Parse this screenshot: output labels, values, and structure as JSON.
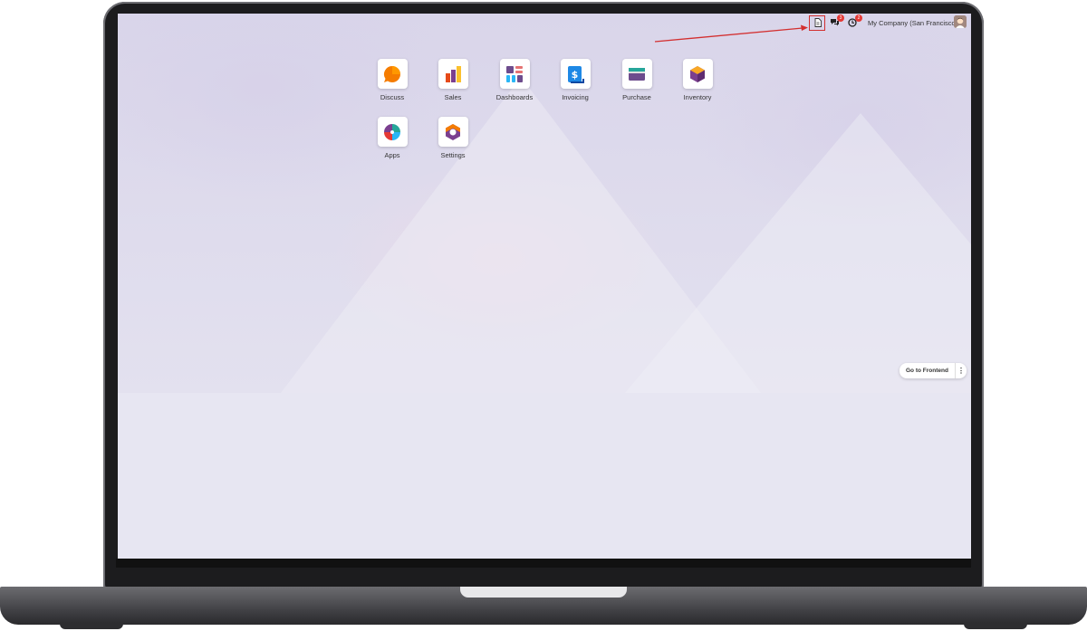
{
  "systray": {
    "company_name": "My Company (San Francisco)",
    "messages_badge": "3",
    "activities_badge": "2",
    "icons": [
      "document-icon",
      "chat-icon",
      "clock-icon",
      "user-avatar"
    ]
  },
  "apps": [
    {
      "label": "Discuss",
      "icon": "discuss-icon"
    },
    {
      "label": "Sales",
      "icon": "sales-icon"
    },
    {
      "label": "Dashboards",
      "icon": "dashboards-icon"
    },
    {
      "label": "Invoicing",
      "icon": "invoicing-icon"
    },
    {
      "label": "Purchase",
      "icon": "purchase-icon"
    },
    {
      "label": "Inventory",
      "icon": "inventory-icon"
    },
    {
      "label": "Apps",
      "icon": "apps-icon"
    },
    {
      "label": "Settings",
      "icon": "settings-icon"
    }
  ],
  "frontend": {
    "label": "Go to Frontend",
    "more": "⋮"
  },
  "colors": {
    "annotation_red": "#d32f2f",
    "badge_red": "#e53935"
  }
}
